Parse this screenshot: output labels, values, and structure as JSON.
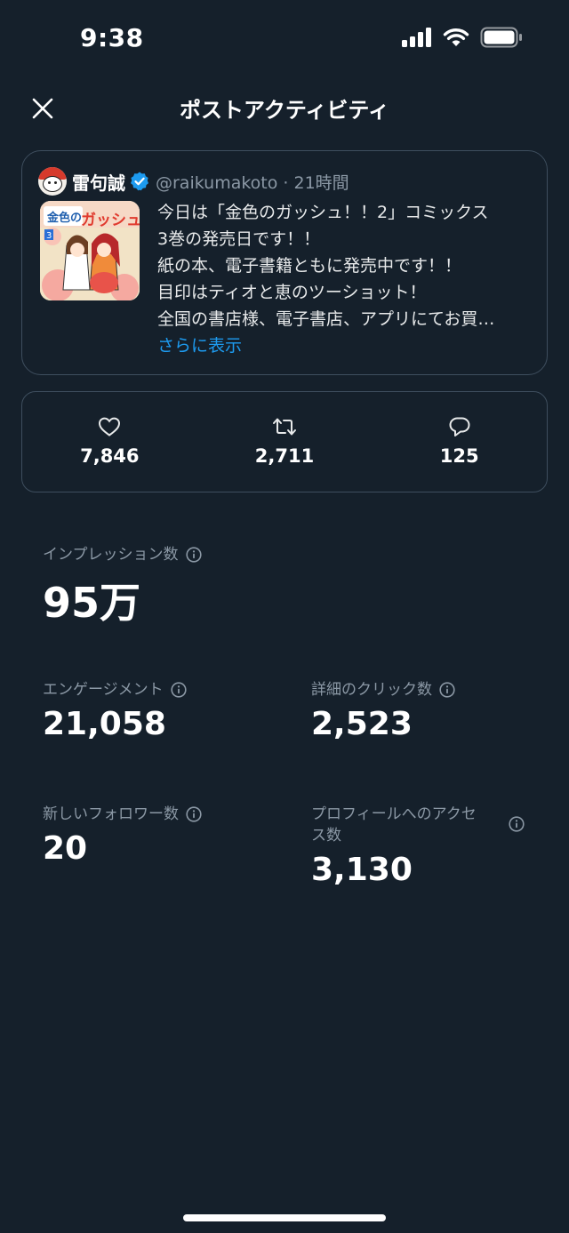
{
  "status_bar": {
    "time": "9:38"
  },
  "nav": {
    "title": "ポストアクティビティ"
  },
  "post": {
    "author_name": "雷句誠",
    "handle_time": "@raikumakoto · 21時間",
    "lines": [
      "今日は「金色のガッシュ！！2」コミックス",
      "3巻の発売日です！！",
      "紙の本、電子書籍ともに発売中です！！",
      "目印はティオと恵のツーショット！",
      "全国の書店様、電子書店、アプリにてお買…"
    ],
    "show_more": "さらに表示",
    "thumb_title": "ガッシュ!!"
  },
  "engagement_summary": {
    "likes": "7,846",
    "reposts": "2,711",
    "replies": "125"
  },
  "metrics": {
    "impressions": {
      "label": "インプレッション数",
      "value": "95万"
    },
    "engagements": {
      "label": "エンゲージメント",
      "value": "21,058"
    },
    "detail_clicks": {
      "label": "詳細のクリック数",
      "value": "2,523"
    },
    "new_followers": {
      "label": "新しいフォロワー数",
      "value": "20"
    },
    "profile_visits": {
      "label_line1": "プロフィールへのアクセ",
      "label_line2": "ス数",
      "value": "3,130"
    }
  },
  "colors": {
    "background": "#15202b",
    "accent": "#1d9bf0",
    "border": "#3e4e5e",
    "muted": "#8b98a5"
  }
}
